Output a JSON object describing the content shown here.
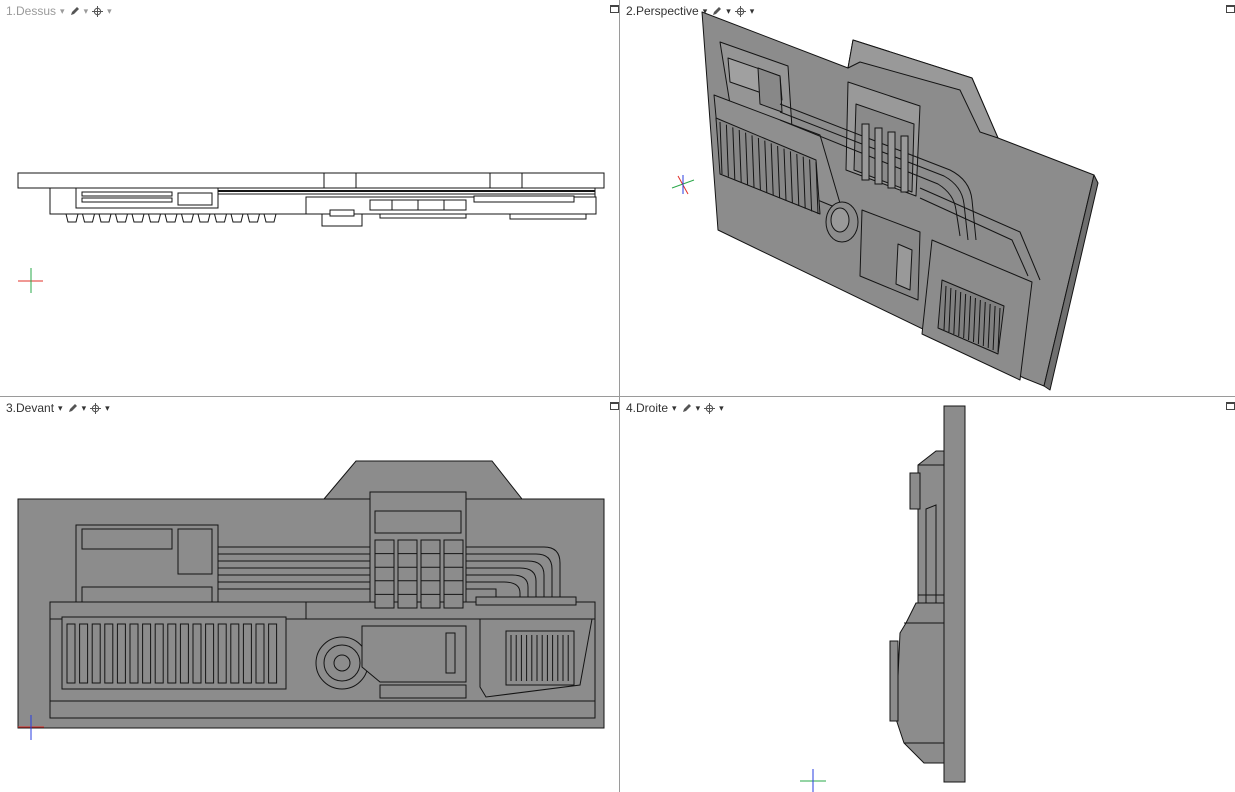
{
  "viewports": [
    {
      "label": "1.Dessus",
      "active": false
    },
    {
      "label": "2.Perspective",
      "active": true
    },
    {
      "label": "3.Devant",
      "active": true
    },
    {
      "label": "4.Droite",
      "active": true
    }
  ],
  "colors": {
    "model_fill": "#8c8c8c",
    "outline": "#141414",
    "axis_x": "#e0302a",
    "axis_y": "#2aa84a",
    "axis_z": "#2a3ee0",
    "divider": "#9a9a9a"
  },
  "icons": [
    "pencil-icon",
    "crosshair-icon",
    "maximize-icon"
  ]
}
